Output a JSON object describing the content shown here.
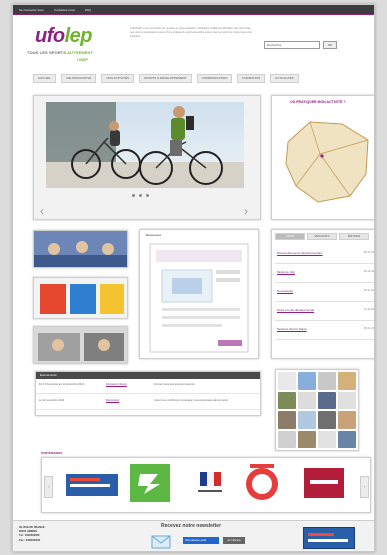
{
  "topbar": {
    "links": [
      "Se connecter avec",
      "Contactez-nous",
      "FAQ"
    ]
  },
  "brand": {
    "name_a": "ufo",
    "name_b": "lep",
    "tagline_a": "TOUS LES SPORTS ",
    "tagline_b": "AUTREMENT",
    "tagline_sub": "USEP"
  },
  "intro_text": "L'UFOLEP, c'est une double vie, sportive et socio-éducative. Fédération multisports affinitaire, elle rassemble des clubs et associations autour d'une pratique du sport accessible à tous, dans un esprit de citoyenneté et de solidarité.",
  "search": {
    "placeholder": "Recherche",
    "button": "OK"
  },
  "nav": [
    "ACCUEIL",
    "VIE ASSOCIATIVE",
    "NOS ACTIVITÉS",
    "SPORTS & DÉVELOPPEMENT",
    "COMMUNICATION",
    "FORMATION",
    "ACTUALITÉS"
  ],
  "map": {
    "title": "OÙ PRATIQUER MON ACTIVITÉ ?"
  },
  "doc": {
    "title": "Bienvenue"
  },
  "news": {
    "tabs": [
      "INFOS",
      "RÉSULTATS",
      "ÉDITIONS"
    ],
    "items": [
      {
        "title": "Rassemblements départementaux",
        "date": "05-12-2014"
      },
      {
        "title": "Mode de club",
        "date": "02-12-2014"
      },
      {
        "title": "Nouveautés",
        "date": "26-11-2014"
      },
      {
        "title": "Notre comité départemental",
        "date": "21-11-2014"
      },
      {
        "title": "Sections Sports Santé",
        "date": "08-11-2014"
      }
    ]
  },
  "agenda": {
    "heading": "Événements",
    "rows": [
      {
        "date": "Du 17 décembre au 12 décembre 2014",
        "link": "Formation Fitness",
        "desc": "Formez-vous aux premiers secours"
      },
      {
        "date": "Le 22 novembre 2014",
        "link": "Rencontres",
        "desc": "Venez vous confronter et partager vos expériences dans le sport"
      }
    ]
  },
  "partners": {
    "title": "PARTENAIRES"
  },
  "footer": {
    "address": [
      "39, RUE DE FRANCE",
      "80000 AMIENS",
      "Tél : 0322000000",
      "Fax : 0322000000"
    ],
    "newsletter_heading": "Recevez notre newsletter",
    "newsletter_input": "Votre adresse email",
    "newsletter_button": "Je m'abonne"
  }
}
